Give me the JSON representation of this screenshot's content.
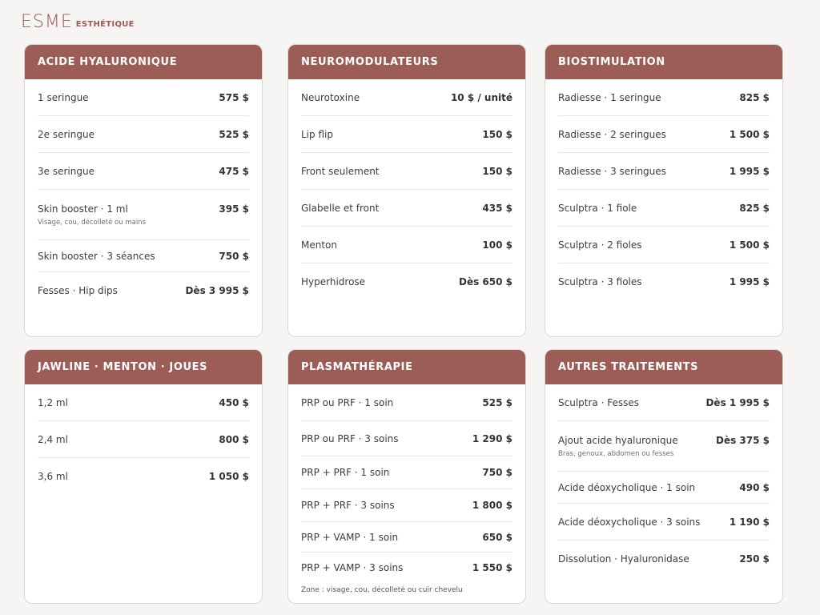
{
  "brand": {
    "mark": "ESME",
    "sub": "ESTHÉTIQUE"
  },
  "cards": [
    {
      "title": "ACIDE HYALURONIQUE",
      "rows": [
        {
          "name": "1 seringue",
          "price": "575 $"
        },
        {
          "name": "2e seringue",
          "price": "525 $"
        },
        {
          "name": "3e seringue",
          "price": "475 $"
        },
        {
          "name": "Skin booster · 1 ml",
          "price": "395 $",
          "sub": "Visage, cou, décolleté ou mains"
        },
        {
          "name": "Skin booster · 3 séances",
          "price": "750 $"
        },
        {
          "name": "Fesses · Hip dips",
          "price": "Dès 3 995 $"
        }
      ]
    },
    {
      "title": "NEUROMODULATEURS",
      "rows": [
        {
          "name": "Neurotoxine",
          "price": "10 $ / unité"
        },
        {
          "name": "Lip flip",
          "price": "150 $"
        },
        {
          "name": "Front seulement",
          "price": "150 $"
        },
        {
          "name": "Glabelle et front",
          "price": "435 $"
        },
        {
          "name": "Menton",
          "price": "100 $"
        },
        {
          "name": "Hyperhidrose",
          "price": "Dès 650 $"
        }
      ]
    },
    {
      "title": "BIOSTIMULATION",
      "rows": [
        {
          "name": "Radiesse · 1 seringue",
          "price": "825 $"
        },
        {
          "name": "Radiesse · 2 seringues",
          "price": "1 500 $"
        },
        {
          "name": "Radiesse · 3 seringues",
          "price": "1 995 $"
        },
        {
          "name": "Sculptra · 1 fiole",
          "price": "825 $"
        },
        {
          "name": "Sculptra · 2 fioles",
          "price": "1 500 $"
        },
        {
          "name": "Sculptra · 3 fioles",
          "price": "1 995 $"
        }
      ]
    },
    {
      "title": "JAWLINE · MENTON · JOUES",
      "rows": [
        {
          "name": "1,2 ml",
          "price": "450 $"
        },
        {
          "name": "2,4 ml",
          "price": "800 $"
        },
        {
          "name": "3,6 ml",
          "price": "1 050 $"
        }
      ]
    },
    {
      "title": "PLASMATHÉRAPIE",
      "rows": [
        {
          "name": "PRP ou PRF · 1 soin",
          "price": "525 $"
        },
        {
          "name": "PRP ou PRF · 3 soins",
          "price": "1 290 $"
        },
        {
          "name": "PRP + PRF · 1 soin",
          "price": "750 $"
        },
        {
          "name": "PRP + PRF · 3 soins",
          "price": "1 800 $"
        },
        {
          "name": "PRP + VAMP · 1 soin",
          "price": "650 $"
        },
        {
          "name": "PRP + VAMP · 3 soins",
          "price": "1 550 $"
        }
      ],
      "note": "Zone : visage, cou, décolleté ou cuir chevelu"
    },
    {
      "title": "AUTRES TRAITEMENTS",
      "rows": [
        {
          "name": "Sculptra · Fesses",
          "price": "Dès 1 995 $"
        },
        {
          "name": "Ajout acide hyaluronique",
          "price": "Dès 375 $",
          "sub": "Bras, genoux, abdomen ou fesses"
        },
        {
          "name": "Acide déoxycholique · 1 soin",
          "price": "490 $"
        },
        {
          "name": "Acide déoxycholique · 3 soins",
          "price": "1 190 $"
        },
        {
          "name": "Dissolution · Hyaluronidase",
          "price": "250 $"
        }
      ]
    }
  ]
}
